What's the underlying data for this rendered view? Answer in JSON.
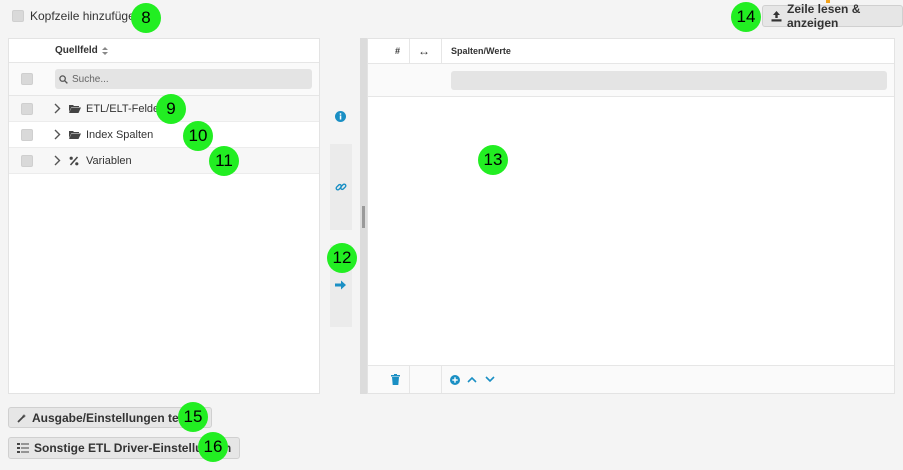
{
  "header_checkbox": {
    "label": "Kopfzeile hinzufügen"
  },
  "read_button": {
    "label": "Zeile lesen & anzeigen"
  },
  "left_panel": {
    "column_header": "Quellfeld",
    "search_placeholder": "Suche...",
    "items": [
      {
        "label": "ETL/ELT-Felder",
        "icon": "folder-open-icon"
      },
      {
        "label": "Index Spalten",
        "icon": "folder-open-icon"
      },
      {
        "label": "Variablen",
        "icon": "percent-icon"
      }
    ]
  },
  "right_panel": {
    "col_index": "#",
    "col_width": "↔",
    "col_values": "Spalten/Werte"
  },
  "bottom_buttons": {
    "test": "Ausgabe/Einstellungen testen",
    "driver": "Sonstige ETL Driver-Einstellungen"
  },
  "markers": [
    "8",
    "9",
    "10",
    "11",
    "12",
    "13",
    "14",
    "15",
    "16"
  ],
  "colors": {
    "accent": "#1a8fc4",
    "marker": "#22ee22"
  }
}
